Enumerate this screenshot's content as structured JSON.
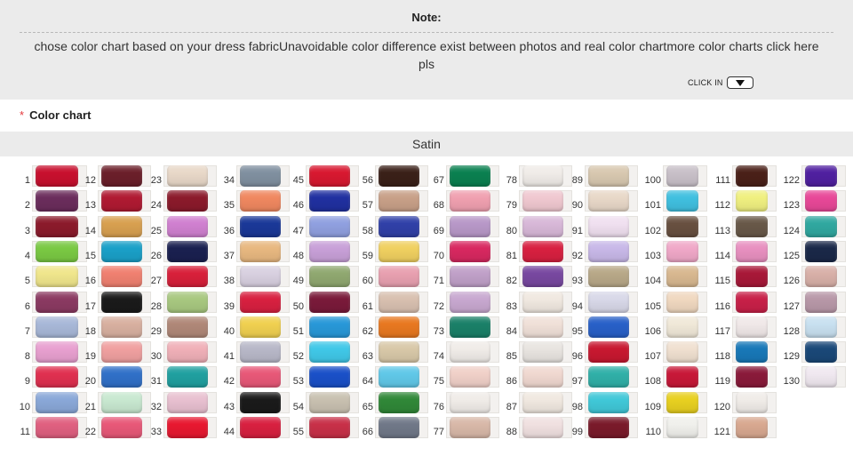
{
  "note": {
    "title": "Note:",
    "text": "chose color chart based on your dress fabricUnavoidable color difference exist between photos and real color chartmore color charts click here pls",
    "click_in_label": "CLICK IN"
  },
  "section": {
    "star": "*",
    "label": "Color chart"
  },
  "fabric": {
    "label": "Satin"
  },
  "swatches": [
    {
      "num": "1",
      "color": "#c8102e"
    },
    {
      "num": "2",
      "color": "#6b2d5c"
    },
    {
      "num": "3",
      "color": "#8b1a2b"
    },
    {
      "num": "4",
      "color": "#7ac943"
    },
    {
      "num": "5",
      "color": "#f0e68c"
    },
    {
      "num": "6",
      "color": "#8b3a62"
    },
    {
      "num": "7",
      "color": "#a8b8d8"
    },
    {
      "num": "8",
      "color": "#e8a0d0"
    },
    {
      "num": "9",
      "color": "#e03050"
    },
    {
      "num": "10",
      "color": "#8aa8d8"
    },
    {
      "num": "11",
      "color": "#e06080"
    },
    {
      "num": "12",
      "color": "#6b1f2a"
    },
    {
      "num": "13",
      "color": "#b01a32"
    },
    {
      "num": "14",
      "color": "#d8a050"
    },
    {
      "num": "15",
      "color": "#1aa0c8"
    },
    {
      "num": "16",
      "color": "#f08070"
    },
    {
      "num": "17",
      "color": "#1a1a1a"
    },
    {
      "num": "18",
      "color": "#d8b0a0"
    },
    {
      "num": "19",
      "color": "#f0a0a0"
    },
    {
      "num": "20",
      "color": "#3070c8"
    },
    {
      "num": "21",
      "color": "#c8e8d0"
    },
    {
      "num": "22",
      "color": "#e85878"
    },
    {
      "num": "23",
      "color": "#e8d8c8"
    },
    {
      "num": "24",
      "color": "#8b1a2b"
    },
    {
      "num": "25",
      "color": "#d080d0"
    },
    {
      "num": "26",
      "color": "#1a2050"
    },
    {
      "num": "27",
      "color": "#d8203a"
    },
    {
      "num": "28",
      "color": "#a8c880"
    },
    {
      "num": "29",
      "color": "#b08878"
    },
    {
      "num": "30",
      "color": "#f0b0b8"
    },
    {
      "num": "31",
      "color": "#20a0a0"
    },
    {
      "num": "32",
      "color": "#e8c0d0"
    },
    {
      "num": "33",
      "color": "#e81830"
    },
    {
      "num": "34",
      "color": "#8090a0"
    },
    {
      "num": "35",
      "color": "#f08860"
    },
    {
      "num": "36",
      "color": "#1a3898"
    },
    {
      "num": "37",
      "color": "#e8b880"
    },
    {
      "num": "38",
      "color": "#d8d0e0"
    },
    {
      "num": "39",
      "color": "#d82040"
    },
    {
      "num": "40",
      "color": "#f0d050"
    },
    {
      "num": "41",
      "color": "#b8b8c8"
    },
    {
      "num": "42",
      "color": "#e85878"
    },
    {
      "num": "43",
      "color": "#1a1a1a"
    },
    {
      "num": "44",
      "color": "#d82040"
    },
    {
      "num": "45",
      "color": "#d81830"
    },
    {
      "num": "46",
      "color": "#2030a0"
    },
    {
      "num": "47",
      "color": "#90a0e0"
    },
    {
      "num": "48",
      "color": "#c8a0d8"
    },
    {
      "num": "49",
      "color": "#90a870"
    },
    {
      "num": "50",
      "color": "#7a1a3a"
    },
    {
      "num": "51",
      "color": "#2898d8"
    },
    {
      "num": "52",
      "color": "#40c8e8"
    },
    {
      "num": "53",
      "color": "#1a50c8"
    },
    {
      "num": "54",
      "color": "#c8c0b0"
    },
    {
      "num": "55",
      "color": "#c83048"
    },
    {
      "num": "56",
      "color": "#3a2018"
    },
    {
      "num": "57",
      "color": "#c8a088"
    },
    {
      "num": "58",
      "color": "#3040a8"
    },
    {
      "num": "59",
      "color": "#f0d060"
    },
    {
      "num": "60",
      "color": "#e8a0b0"
    },
    {
      "num": "61",
      "color": "#d8c0b0"
    },
    {
      "num": "62",
      "color": "#e87820"
    },
    {
      "num": "63",
      "color": "#d8c8a8"
    },
    {
      "num": "64",
      "color": "#60c8e8"
    },
    {
      "num": "65",
      "color": "#308838"
    },
    {
      "num": "66",
      "color": "#707888"
    },
    {
      "num": "67",
      "color": "#0a8050"
    },
    {
      "num": "68",
      "color": "#f0a0b0"
    },
    {
      "num": "69",
      "color": "#b898c8"
    },
    {
      "num": "70",
      "color": "#d82860"
    },
    {
      "num": "71",
      "color": "#c0a0c8"
    },
    {
      "num": "72",
      "color": "#c8a8d0"
    },
    {
      "num": "73",
      "color": "#1a8068"
    },
    {
      "num": "74",
      "color": "#f0ece8"
    },
    {
      "num": "75",
      "color": "#f0d0c8"
    },
    {
      "num": "76",
      "color": "#f0ece8"
    },
    {
      "num": "77",
      "color": "#d8b8a8"
    },
    {
      "num": "78",
      "color": "#f0ece8"
    },
    {
      "num": "79",
      "color": "#f0c8d0"
    },
    {
      "num": "80",
      "color": "#d8b8d8"
    },
    {
      "num": "81",
      "color": "#d82040"
    },
    {
      "num": "82",
      "color": "#7848a0"
    },
    {
      "num": "83",
      "color": "#f0e8e0"
    },
    {
      "num": "84",
      "color": "#f0e0d8"
    },
    {
      "num": "85",
      "color": "#e8e4e0"
    },
    {
      "num": "86",
      "color": "#f0d8d0"
    },
    {
      "num": "87",
      "color": "#f0e8e0"
    },
    {
      "num": "88",
      "color": "#f0e0e0"
    },
    {
      "num": "89",
      "color": "#d8c8b0"
    },
    {
      "num": "90",
      "color": "#e8d8c8"
    },
    {
      "num": "91",
      "color": "#f0e0f0"
    },
    {
      "num": "92",
      "color": "#c8b8e8"
    },
    {
      "num": "93",
      "color": "#b8a888"
    },
    {
      "num": "94",
      "color": "#d8d8e8"
    },
    {
      "num": "95",
      "color": "#2860c8"
    },
    {
      "num": "96",
      "color": "#c81830"
    },
    {
      "num": "97",
      "color": "#30b0a8"
    },
    {
      "num": "98",
      "color": "#40c8d8"
    },
    {
      "num": "99",
      "color": "#7a1a2a"
    },
    {
      "num": "100",
      "color": "#c8c0c8"
    },
    {
      "num": "101",
      "color": "#40c0e0"
    },
    {
      "num": "102",
      "color": "#685040"
    },
    {
      "num": "103",
      "color": "#f0a8c8"
    },
    {
      "num": "104",
      "color": "#d8b890"
    },
    {
      "num": "105",
      "color": "#f0d8c0"
    },
    {
      "num": "106",
      "color": "#f0e8d8"
    },
    {
      "num": "107",
      "color": "#f0e0d0"
    },
    {
      "num": "108",
      "color": "#c81838"
    },
    {
      "num": "109",
      "color": "#e8d020"
    },
    {
      "num": "110",
      "color": "#f0f0ec"
    },
    {
      "num": "111",
      "color": "#4a2018"
    },
    {
      "num": "112",
      "color": "#f0f080"
    },
    {
      "num": "113",
      "color": "#685848"
    },
    {
      "num": "114",
      "color": "#e890c0"
    },
    {
      "num": "115",
      "color": "#a81838"
    },
    {
      "num": "116",
      "color": "#c82048"
    },
    {
      "num": "117",
      "color": "#f0e8e8"
    },
    {
      "num": "118",
      "color": "#1878b8"
    },
    {
      "num": "119",
      "color": "#8a1a3a"
    },
    {
      "num": "120",
      "color": "#f0ece8"
    },
    {
      "num": "121",
      "color": "#d8a890"
    },
    {
      "num": "122",
      "color": "#5020a0"
    },
    {
      "num": "123",
      "color": "#e84898"
    },
    {
      "num": "124",
      "color": "#30a8a0"
    },
    {
      "num": "125",
      "color": "#1a2848"
    },
    {
      "num": "126",
      "color": "#d8b0a8"
    },
    {
      "num": "127",
      "color": "#b898a8"
    },
    {
      "num": "128",
      "color": "#c8e0f0"
    },
    {
      "num": "129",
      "color": "#1a4878"
    },
    {
      "num": "130",
      "color": "#f0e8f0"
    }
  ]
}
